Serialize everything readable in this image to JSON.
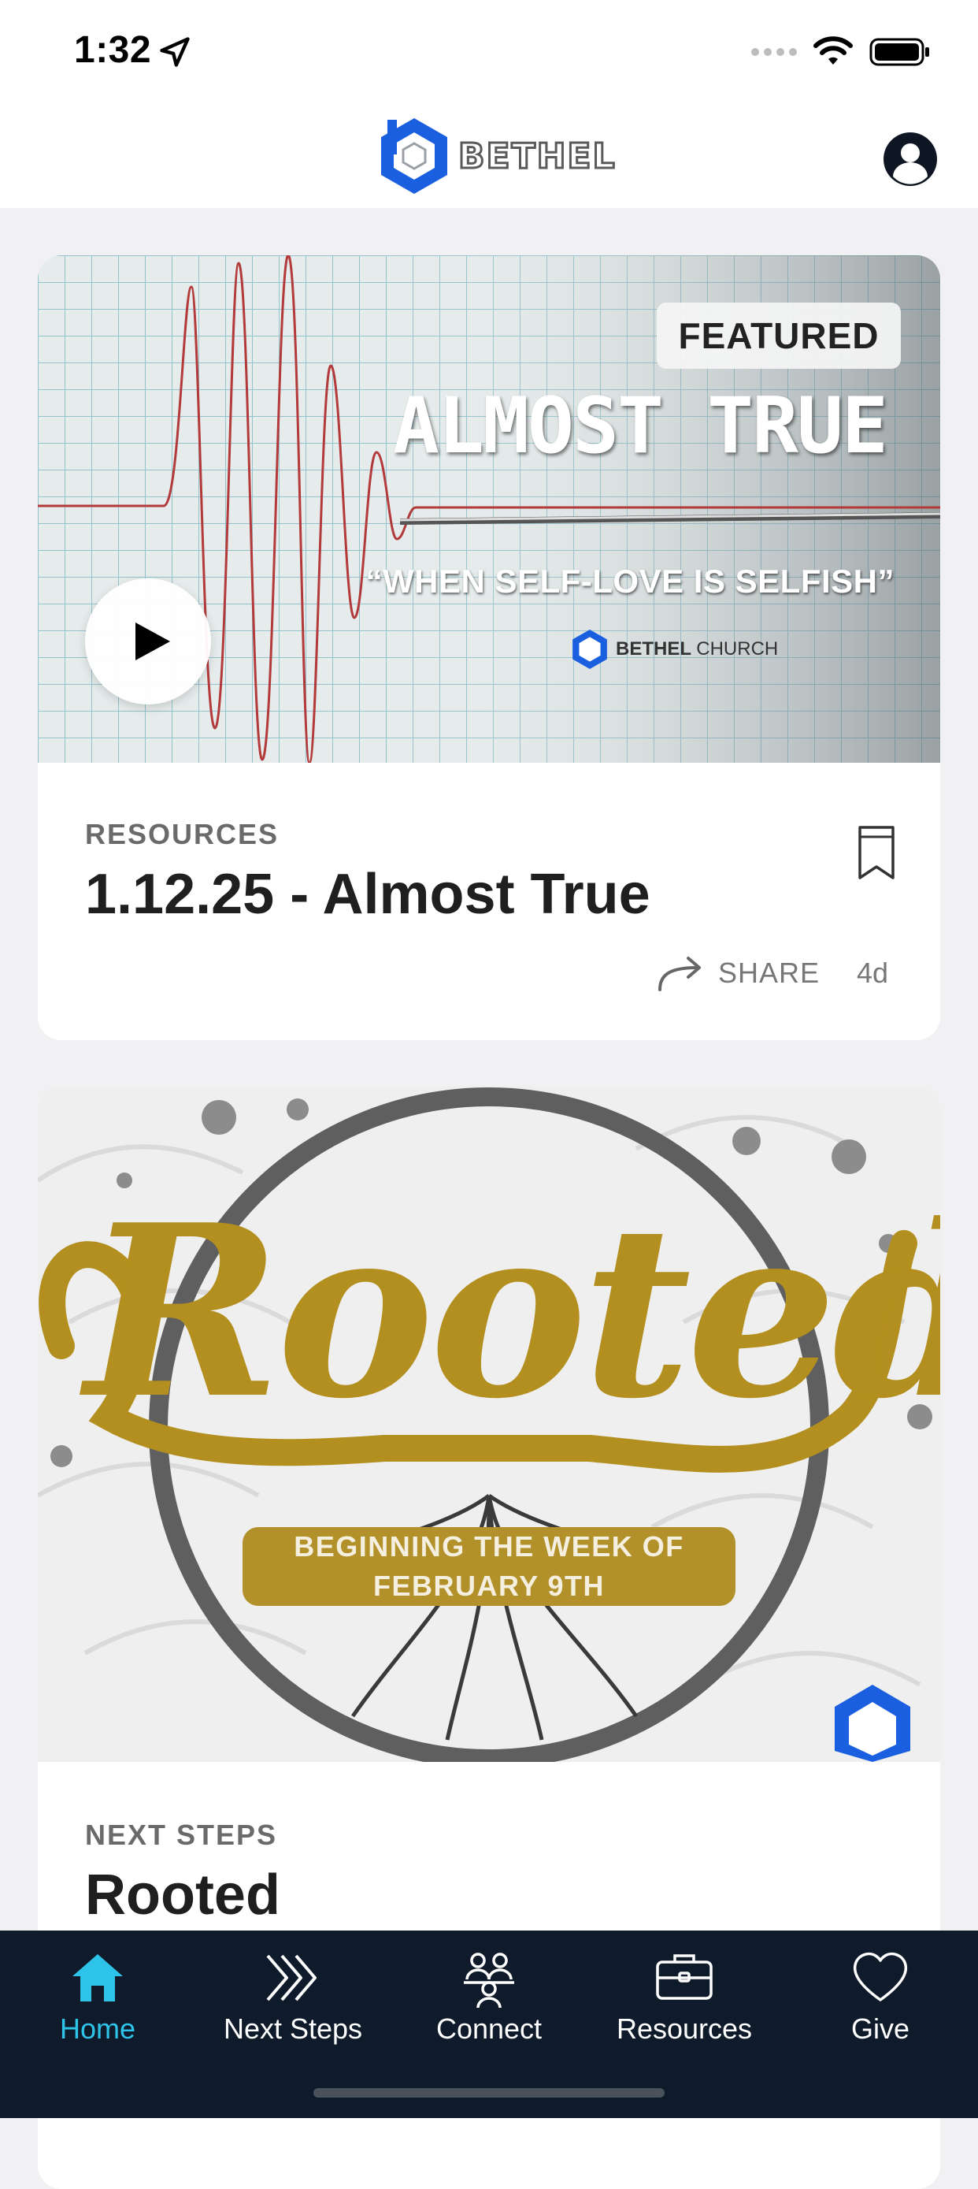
{
  "status_bar": {
    "time": "1:32"
  },
  "header": {
    "logo_text": "BETHEL"
  },
  "cards": [
    {
      "badge": "FEATURED",
      "image_title": "ALMOST TRUE",
      "image_subtitle": "“WHEN SELF-LOVE IS SELFISH”",
      "image_church_bold": "BETHEL",
      "image_church_light": "CHURCH",
      "category": "RESOURCES",
      "title": "1.12.25 - Almost True",
      "share_label": "SHARE",
      "age": "4d"
    },
    {
      "image_word": "Rooted",
      "image_banner_line1": "BEGINNING THE WEEK OF",
      "image_banner_line2": "FEBRUARY 9TH",
      "category": "NEXT STEPS",
      "title": "Rooted"
    }
  ],
  "tabs": [
    {
      "label": "Home",
      "icon": "home-icon",
      "active": true
    },
    {
      "label": "Next Steps",
      "icon": "chevrons-icon",
      "active": false
    },
    {
      "label": "Connect",
      "icon": "people-icon",
      "active": false
    },
    {
      "label": "Resources",
      "icon": "briefcase-icon",
      "active": false
    },
    {
      "label": "Give",
      "icon": "heart-icon",
      "active": false
    }
  ],
  "colors": {
    "accent": "#2ec4ea",
    "tabbar_bg": "#0f1b2b",
    "logo_blue": "#1a5fe0",
    "rooted_gold": "#b38f1f"
  }
}
